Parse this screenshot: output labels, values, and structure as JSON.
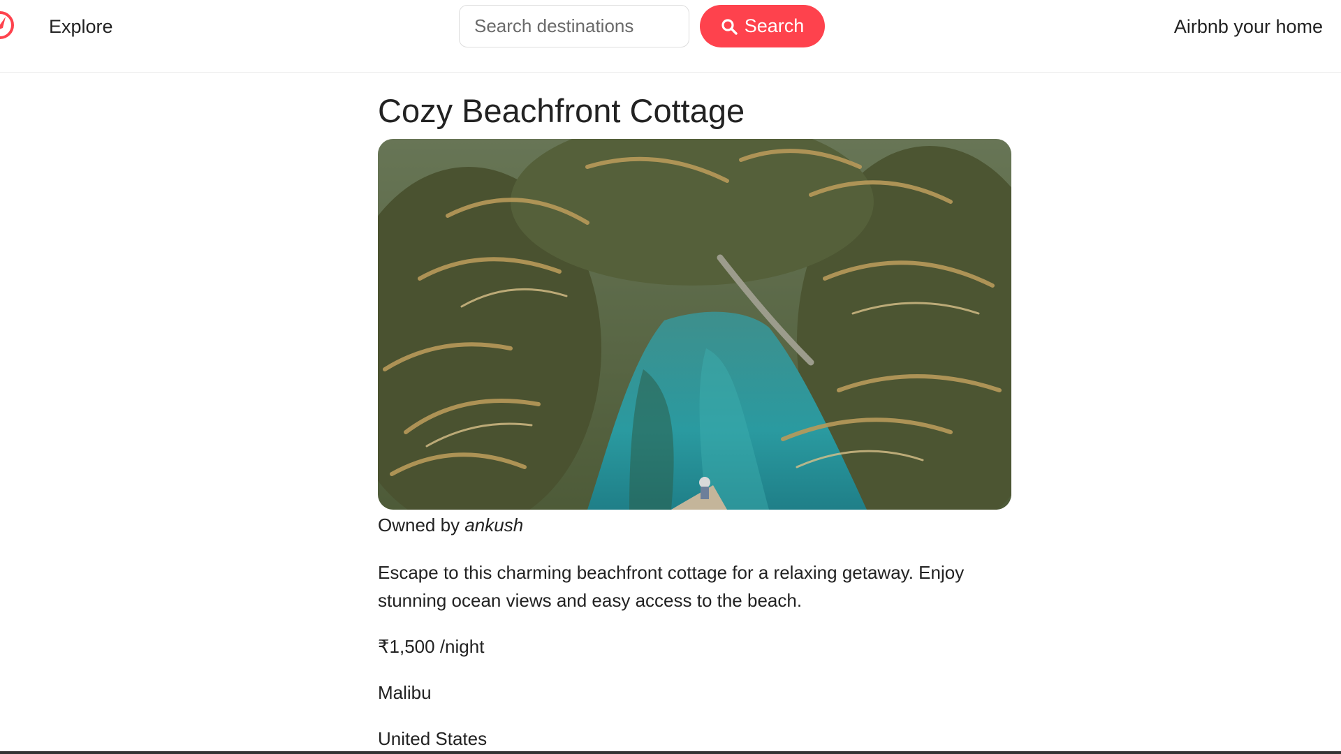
{
  "navbar": {
    "logo_icon": "compass-icon",
    "brand_color": "#fe424d",
    "explore_label": "Explore",
    "search_placeholder": "Search destinations",
    "search_value": "",
    "search_button_label": "Search",
    "search_button_icon": "search-icon",
    "host_label": "Airbnb your home"
  },
  "listing": {
    "title": "Cozy Beachfront Cottage",
    "image_subject": "tropical-lagoon-photo",
    "owner_prefix": "Owned by",
    "owner_name": "ankush",
    "description": "Escape to this charming beachfront cottage for a relaxing getaway. Enjoy stunning ocean views and easy access to the beach.",
    "price": "₹1,500 /night",
    "location": "Malibu",
    "country": "United States"
  }
}
